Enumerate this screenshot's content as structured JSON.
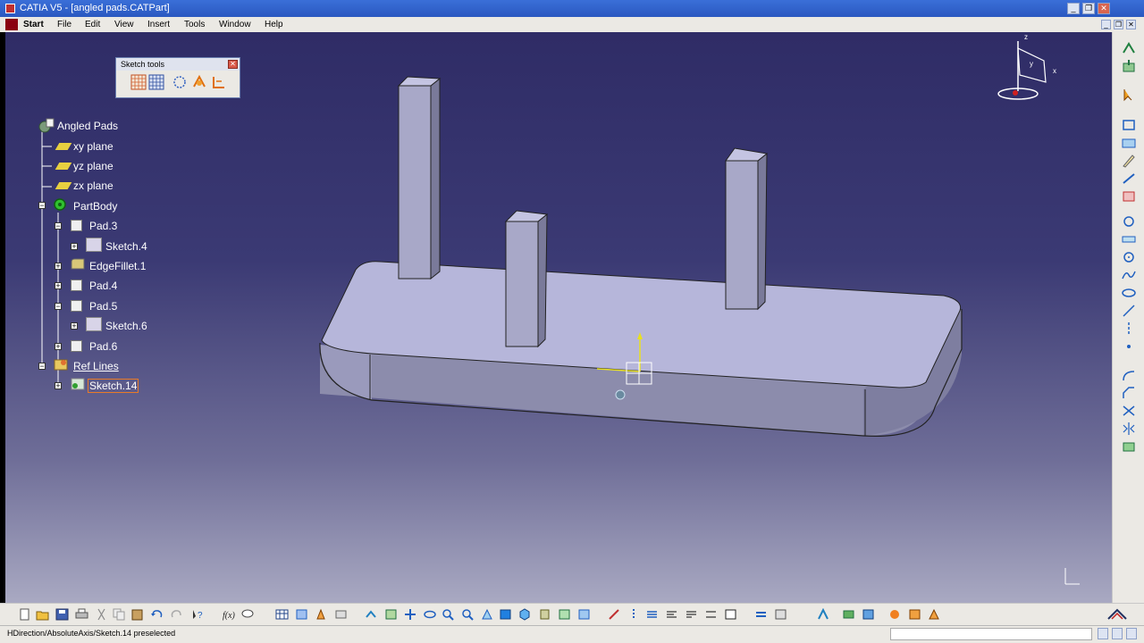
{
  "window": {
    "title": "CATIA V5 - [angled pads.CATPart]",
    "controls": {
      "minimize": "_",
      "restore": "❐",
      "close": "✕"
    }
  },
  "menubar": {
    "items": [
      "Start",
      "File",
      "Edit",
      "View",
      "Insert",
      "Tools",
      "Window",
      "Help"
    ]
  },
  "sketch_tools": {
    "title": "Sketch tools",
    "icons": [
      "grid-icon",
      "snap-to-point-icon",
      "construction-element-icon",
      "geometric-constraints-icon",
      "dimensional-constraints-icon"
    ]
  },
  "tree": {
    "root": "Angled Pads",
    "xy_plane": "xy plane",
    "yz_plane": "yz plane",
    "zx_plane": "zx plane",
    "part_body": "PartBody",
    "pad3": "Pad.3",
    "sketch4": "Sketch.4",
    "edgefillet1": "EdgeFillet.1",
    "pad4": "Pad.4",
    "pad5": "Pad.5",
    "sketch6": "Sketch.6",
    "pad6": "Pad.6",
    "ref_lines": "Ref Lines",
    "sketch14": "Sketch.14"
  },
  "compass": {
    "x": "x",
    "y": "y",
    "z": "z"
  },
  "status": {
    "text": "HDirection/AbsoluteAxis/Sketch.14 preselected"
  },
  "colors": {
    "viewport_top": "#2f2c66",
    "viewport_bottom": "#a9a9c2",
    "part_top": "#b4b4da",
    "part_front": "#8a8aaa",
    "toolbar": "#ebe9e4",
    "titlebar": "#2a58c0",
    "selection": "#e87a28"
  }
}
